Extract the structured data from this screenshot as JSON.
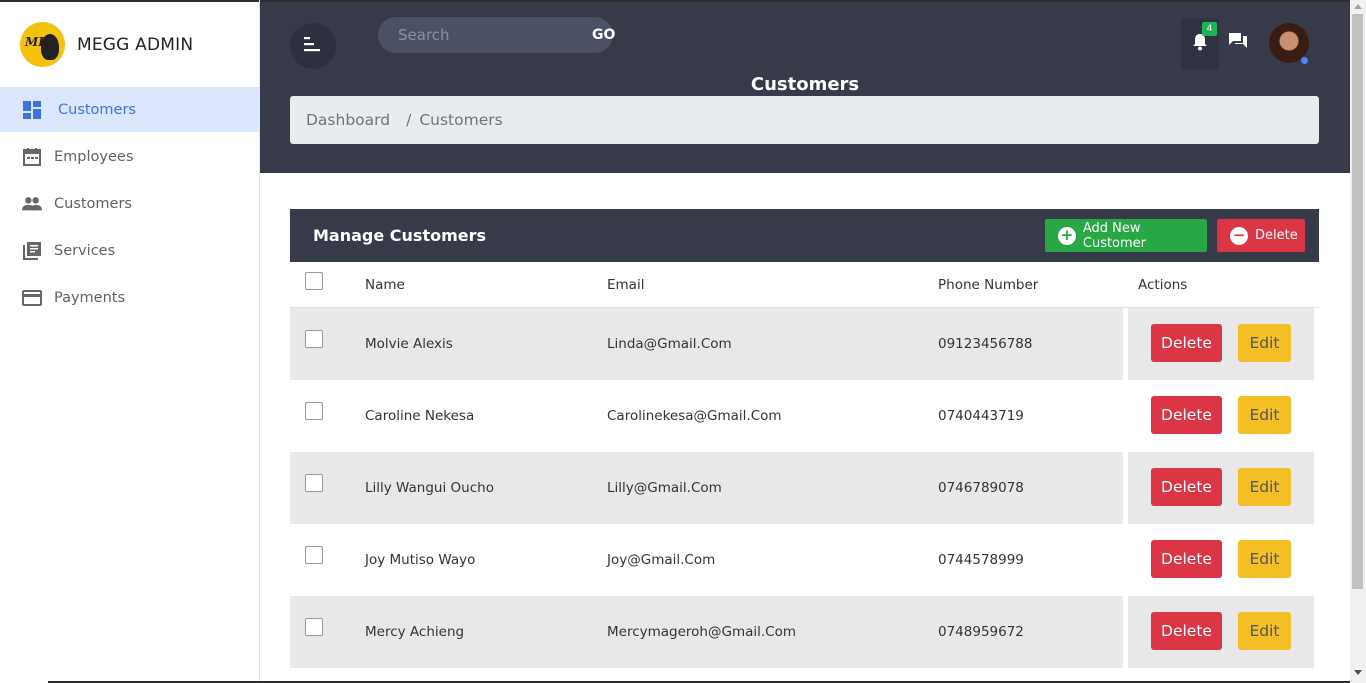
{
  "brand": {
    "name": "MEGG ADMIN",
    "logo_text": "MB"
  },
  "sidebar": {
    "items": [
      {
        "label": "Customers",
        "icon": "dashboard-icon",
        "active": true
      },
      {
        "label": "Employees",
        "icon": "calendar-icon",
        "active": false
      },
      {
        "label": "Customers",
        "icon": "people-icon",
        "active": false
      },
      {
        "label": "Services",
        "icon": "library-books-icon",
        "active": false
      },
      {
        "label": "Payments",
        "icon": "credit-card-icon",
        "active": false
      }
    ]
  },
  "topbar": {
    "search_placeholder": "Search",
    "go_label": "GO",
    "notification_count": "4",
    "page_title": "Customers"
  },
  "breadcrumb": {
    "home": "Dashboard",
    "separator": "/",
    "current": "Customers"
  },
  "card": {
    "title": "Manage Customers",
    "add_label": "Add New Customer",
    "delete_label": "Delete"
  },
  "table": {
    "headers": {
      "name": "Name",
      "email": "Email",
      "phone": "Phone Number",
      "actions": "Actions"
    },
    "rows": [
      {
        "name": "Molvie Alexis",
        "email": "Linda@Gmail.Com",
        "phone": "09123456788"
      },
      {
        "name": "Caroline Nekesa",
        "email": "Carolinekesa@Gmail.Com",
        "phone": "0740443719"
      },
      {
        "name": "Lilly Wangui Oucho",
        "email": "Lilly@Gmail.Com",
        "phone": "0746789078"
      },
      {
        "name": "Joy Mutiso Wayo",
        "email": "Joy@Gmail.Com",
        "phone": "0744578999"
      },
      {
        "name": "Mercy Achieng",
        "email": "Mercymageroh@Gmail.Com",
        "phone": "0748959672"
      }
    ],
    "row_delete_label": "Delete",
    "row_edit_label": "Edit"
  },
  "colors": {
    "dark": "#363a49",
    "active_bg": "#dbe6fd",
    "active_text": "#3c74e0",
    "green": "#28a745",
    "red": "#dc3545",
    "yellow": "#f5c026"
  }
}
